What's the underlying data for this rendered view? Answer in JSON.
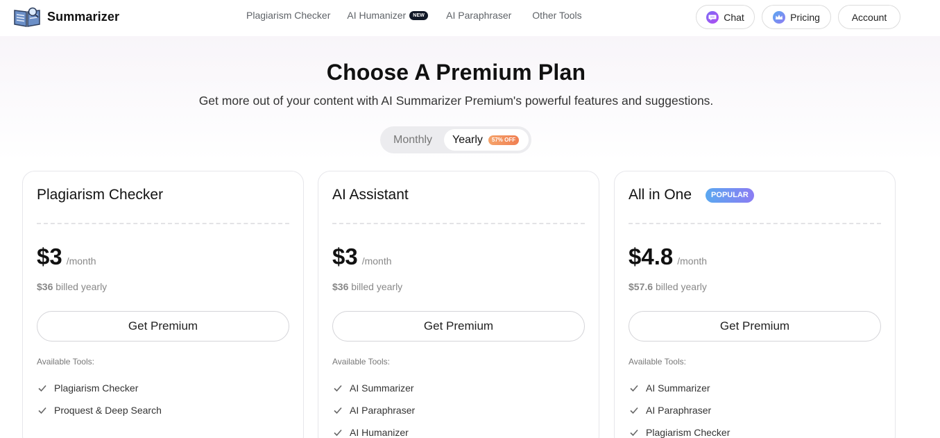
{
  "header": {
    "brand": "Summarizer",
    "nav": [
      {
        "label": "Plagiarism Checker"
      },
      {
        "label": "AI Humanizer",
        "badge": "NEW"
      },
      {
        "label": "AI Paraphraser"
      },
      {
        "label": "Other Tools"
      }
    ],
    "chat_label": "Chat",
    "pricing_label": "Pricing",
    "account_label": "Account"
  },
  "hero": {
    "title": "Choose A Premium Plan",
    "subtitle": "Get more out of your content with AI Summarizer Premium's powerful features and suggestions."
  },
  "billing_toggle": {
    "monthly": "Monthly",
    "yearly": "Yearly",
    "yearly_badge": "57% OFF",
    "selected": "Yearly"
  },
  "plans": [
    {
      "name": "Plagiarism Checker",
      "price": "$3",
      "period": "/month",
      "billed_amount": "$36",
      "billed_text": "billed yearly",
      "cta": "Get Premium",
      "tools_label": "Available Tools:",
      "tools": [
        "Plagiarism Checker",
        "Proquest & Deep Search"
      ]
    },
    {
      "name": "AI Assistant",
      "price": "$3",
      "period": "/month",
      "billed_amount": "$36",
      "billed_text": "billed yearly",
      "cta": "Get Premium",
      "tools_label": "Available Tools:",
      "tools": [
        "AI Summarizer",
        "AI Paraphraser",
        "AI Humanizer"
      ]
    },
    {
      "name": "All in One",
      "badge": "POPULAR",
      "price": "$4.8",
      "period": "/month",
      "billed_amount": "$57.6",
      "billed_text": "billed yearly",
      "cta": "Get Premium",
      "tools_label": "Available Tools:",
      "tools": [
        "AI Summarizer",
        "AI Paraphraser",
        "Plagiarism Checker"
      ]
    }
  ],
  "colors": {
    "accent_badge": "#f07f52",
    "popular_gradient_start": "#5aa8f0",
    "popular_gradient_end": "#8b7cf3",
    "text_primary": "#111111"
  },
  "icons": {
    "brand": "book-magnifier-icon",
    "chat": "chat-bubble-icon",
    "pricing": "crown-icon",
    "tool_check": "check-icon"
  }
}
